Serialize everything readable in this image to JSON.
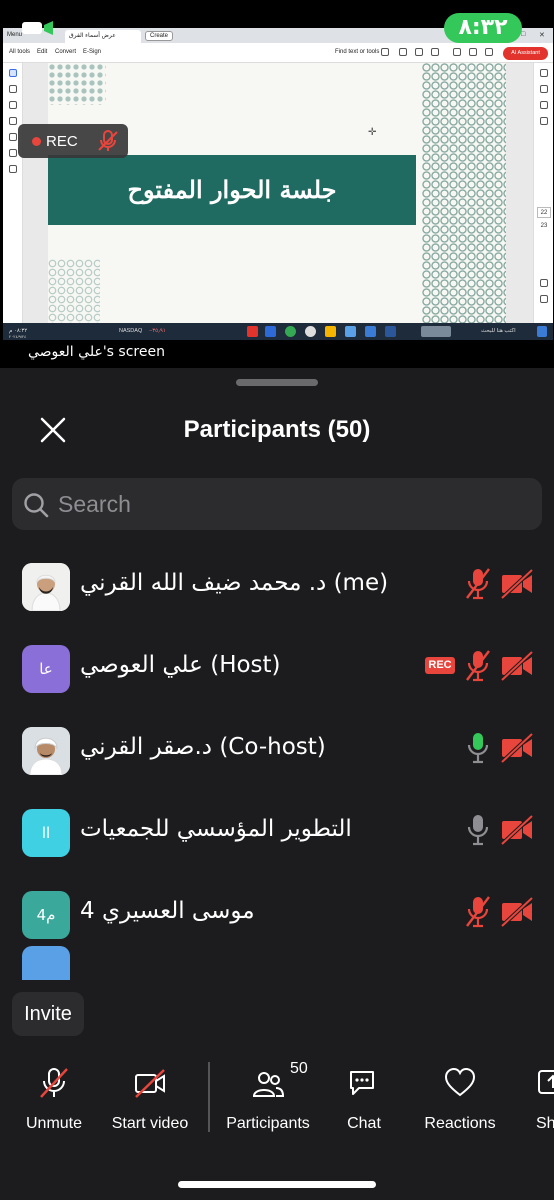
{
  "status_bar": {
    "time": "٨:٣٢"
  },
  "shared_screen": {
    "browser": {
      "menu_label": "Menu",
      "tab_title": "عرض أسماء الفرق",
      "create_label": "Create"
    },
    "pdf_toolbar": {
      "all_tools": "All tools",
      "edit": "Edit",
      "convert": "Convert",
      "esign": "E-Sign",
      "find": "Find text or tools",
      "ai_assistant": "AI Assistant"
    },
    "page_numbers": [
      "22",
      "23"
    ],
    "slide_title": "جلسة الحوار المفتوح",
    "taskbar": {
      "ticker": "NASDAQ",
      "ticker_change": "−٣٥٫٩١",
      "search_placeholder": "اكتب هنا للبحث",
      "time": "٠٨:٣٢ م",
      "date": "٢٠٢٤/٩/٢٤"
    },
    "recording": {
      "label": "REC"
    },
    "caption": "علي العوصي's screen"
  },
  "participants_panel": {
    "title": "Participants (50)",
    "search_placeholder": "Search",
    "participants": [
      {
        "name": "د. محمد ضيف الله القرني (me)",
        "avatar": "photo",
        "mic": "muted",
        "video": "off",
        "rec": false
      },
      {
        "name": "علي العوصي (Host)",
        "avatar_initials": "عا",
        "avatar_color": "#8b6fd8",
        "mic": "muted",
        "video": "off",
        "rec": true,
        "rec_label": "REC"
      },
      {
        "name": "د.صقر القرني (Co-host)",
        "avatar": "photo",
        "mic": "speaking",
        "video": "off",
        "rec": false
      },
      {
        "name": "التطوير  المؤسسي للجمعيات",
        "avatar_initials": "اا",
        "avatar_color": "#3fd1e3",
        "mic": "unmuted",
        "video": "off",
        "rec": false
      },
      {
        "name": "4 موسى العسيري",
        "avatar_initials": "4م",
        "avatar_color": "#3aa89b",
        "mic": "muted",
        "video": "off",
        "rec": false
      }
    ],
    "invite_label": "Invite"
  },
  "bottom_bar": {
    "unmute": "Unmute",
    "start_video": "Start video",
    "participants": "Participants",
    "participants_count": "50",
    "chat": "Chat",
    "reactions": "Reactions",
    "share": "Share"
  },
  "colors": {
    "background": "#1c1c1e",
    "muted_red": "#e8453c",
    "speaking_green": "#34c759",
    "slide_banner": "#1f6b62"
  }
}
